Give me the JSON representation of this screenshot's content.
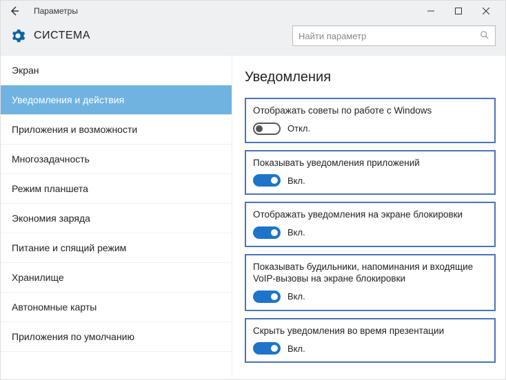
{
  "titlebar": {
    "title": "Параметры"
  },
  "header": {
    "system_label": "СИСТЕМА",
    "search_placeholder": "Найти параметр"
  },
  "sidebar": {
    "items": [
      {
        "label": "Экран",
        "active": false
      },
      {
        "label": "Уведомления и действия",
        "active": true
      },
      {
        "label": "Приложения и возможности",
        "active": false
      },
      {
        "label": "Многозадачность",
        "active": false
      },
      {
        "label": "Режим планшета",
        "active": false
      },
      {
        "label": "Экономия заряда",
        "active": false
      },
      {
        "label": "Питание и спящий режим",
        "active": false
      },
      {
        "label": "Хранилище",
        "active": false
      },
      {
        "label": "Автономные карты",
        "active": false
      },
      {
        "label": "Приложения по умолчанию",
        "active": false
      }
    ]
  },
  "content": {
    "title": "Уведомления",
    "state_on": "Вкл.",
    "state_off": "Откл.",
    "settings": [
      {
        "label": "Отображать советы по работе с Windows",
        "on": false
      },
      {
        "label": "Показывать уведомления приложений",
        "on": true
      },
      {
        "label": "Отображать уведомления на экране блокировки",
        "on": true
      },
      {
        "label": "Показывать будильники, напоминания и входящие VoIP-вызовы на экране блокировки",
        "on": true
      },
      {
        "label": "Скрыть уведомления во время презентации",
        "on": true
      }
    ]
  }
}
